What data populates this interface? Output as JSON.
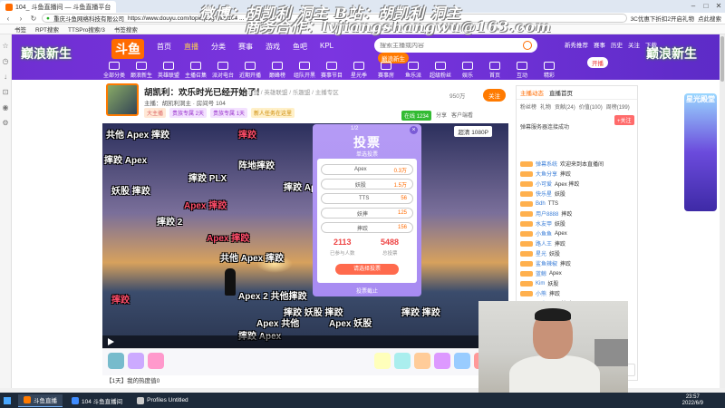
{
  "browser": {
    "tabs": [
      {
        "label": "104_ 斗鱼直播间 — 斗鱼直播平台",
        "active": true
      },
      {
        "label": "",
        "active": false
      }
    ],
    "url": "https://www.douyu.com/topic/jcsg?rid=104 ...",
    "site_label": "重庆斗鱼网络科技有限公司",
    "right_pill": "3C优惠下折扣2开启礼物",
    "search_hint": "点此搜索",
    "bookmarks": [
      "书签",
      "RPT搜索",
      "TTSPro搜索/3",
      "书签搜索"
    ]
  },
  "watermark": {
    "line1": "微博：胡凯利 洞主 B站：胡凯利 洞主",
    "line2": "商务合作：lvjiangshangwu@163.com"
  },
  "header": {
    "banner_left": "巅浪新生",
    "banner_right": "巅浪新生",
    "logo": "斗鱼",
    "nav": [
      "首页",
      "直播",
      "分类",
      "赛事",
      "游戏",
      "鱼吧",
      "KPL"
    ],
    "search_placeholder": "搜索主播或内容",
    "search_badge": "巅浪新生",
    "right_btns": [
      "新秀推荐",
      "赛事",
      "历史",
      "关注",
      "下载"
    ],
    "post_btn": "开播",
    "icons": [
      "全部分类",
      "巅浪新生",
      "英雄联盟",
      "主播召集",
      "派对电台",
      "近期开播",
      "巅峰榜",
      "组队开黑",
      "赛事节目",
      "星光季",
      "赛事房",
      "鱼乐派",
      "超级粉丝",
      "娱乐",
      "首页",
      "互动",
      "精彩"
    ]
  },
  "room": {
    "title": "胡凯利：欢乐时光已经开始了！",
    "category": "斗鱼 / 英雄联盟 / 乐趣盟 / 主播专区",
    "sub": "主播：胡凯利洞主 · 房间号 104",
    "tags": [
      "大主播",
      "贵族专属 2天",
      "贵族专属 1天",
      "新人任务在这里"
    ],
    "follow_label": "关注",
    "follow_count": "950万",
    "online_label": "在线 1234",
    "actions": [
      "分享",
      "客户端看"
    ]
  },
  "danmaku": [
    {
      "text": "共他 Apex 摔跤",
      "style": "w"
    },
    {
      "text": "摔跤",
      "style": "r"
    },
    {
      "text": "摔跤共他",
      "style": "w"
    },
    {
      "text": "摔跤 共他",
      "style": "y"
    },
    {
      "text": "摔跤 Apex",
      "style": "w"
    },
    {
      "text": "阵地摔跤",
      "style": "w"
    },
    {
      "text": "Apex 妖股",
      "style": "w"
    },
    {
      "text": "摔跤 PLX",
      "style": "w"
    },
    {
      "text": "摔跤 Apex",
      "style": "w"
    },
    {
      "text": "妖股 摔跤",
      "style": "w"
    },
    {
      "text": "Apex 摔跤",
      "style": "r"
    },
    {
      "text": "摔跤 摔跤 摔跤",
      "style": "w"
    },
    {
      "text": "Apex 妖股",
      "style": "w"
    },
    {
      "text": "摔跤 2",
      "style": "w"
    },
    {
      "text": "Apex 摔跤",
      "style": "r"
    },
    {
      "text": "共他 Apex 摔跤",
      "style": "w"
    },
    {
      "text": "妖股 Apex",
      "style": "w"
    },
    {
      "text": "Apex 2 共他摔跤",
      "style": "w"
    },
    {
      "text": "摔跤 Apex 妖股",
      "style": "y"
    },
    {
      "text": "摔跤 妖股 摔跤",
      "style": "w"
    },
    {
      "text": "Apex 共他",
      "style": "w"
    },
    {
      "text": "Apex 妖股",
      "style": "w"
    },
    {
      "text": "摔跤 摔跤",
      "style": "w"
    },
    {
      "text": "摔跤 Apex",
      "style": "w"
    },
    {
      "text": "摔跤",
      "style": "r"
    }
  ],
  "player": {
    "mode_label": "超清 1080P"
  },
  "hint": "【1天】我的热度值0",
  "vote": {
    "title": "投票",
    "top": "1/2",
    "sub": "单选投票",
    "options": [
      {
        "name": "Apex",
        "votes": "0.3万"
      },
      {
        "name": "妖股",
        "votes": "1.5万"
      },
      {
        "name": "TTS",
        "votes": "56"
      },
      {
        "name": "妖摔",
        "votes": "125"
      },
      {
        "name": "摔跤",
        "votes": "156"
      }
    ],
    "voters": "2113",
    "voters_label": "已参与人数",
    "total": "5488",
    "total_label": "总投票",
    "button": "请选择投票",
    "footer": "投票截止"
  },
  "chat": {
    "tabs": [
      "主播动态",
      "直播首页"
    ],
    "rank_tabs": [
      "粉丝榜",
      "礼物",
      "贡献(24)",
      "价值(100)",
      "周榜(199)"
    ],
    "fans_btn": "+关注",
    "notice": "弹幕服务器连接成功",
    "lines": [
      {
        "user": "弹幕系统",
        "msg": "欢迎来到本直播间"
      },
      {
        "user": "大鱼分享",
        "msg": "摔跤"
      },
      {
        "user": "小可爱",
        "msg": "Apex 摔跤"
      },
      {
        "user": "快乐星",
        "msg": "妖股"
      },
      {
        "user": "Bdh",
        "msg": "TTS"
      },
      {
        "user": "用户8888",
        "msg": "摔跤"
      },
      {
        "user": "水友甲",
        "msg": "妖股"
      },
      {
        "user": "小鱼鱼",
        "msg": "Apex"
      },
      {
        "user": "路人王",
        "msg": "摔跤"
      },
      {
        "user": "星光",
        "msg": "妖股"
      },
      {
        "user": "鲨鱼辣椒",
        "msg": "摔跤"
      },
      {
        "user": "蓝鲸",
        "msg": "Apex"
      },
      {
        "user": "Kim",
        "msg": "妖股"
      },
      {
        "user": "小熊",
        "msg": "摔跤"
      },
      {
        "user": "用户5213",
        "msg": "摔跤"
      },
      {
        "user": "冷风",
        "msg": "妖股"
      }
    ],
    "input_placeholder": "这里输入聊天内容"
  },
  "promo": {
    "title": "星光殿堂"
  },
  "taskbar": {
    "items": [
      {
        "label": "斗鱼直播",
        "active": true,
        "color": "#ff7a00"
      },
      {
        "label": "104 斗鱼直播间",
        "active": false,
        "color": "#3f8cff"
      },
      {
        "label": "Profiles Untitled",
        "active": false,
        "color": "#cccccc"
      }
    ],
    "time": "23:57",
    "date": "2022/6/9"
  }
}
